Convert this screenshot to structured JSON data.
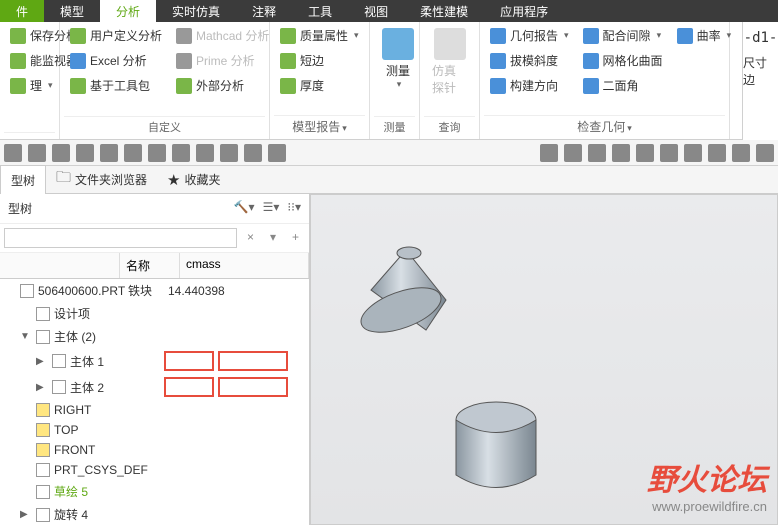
{
  "tabs": [
    "件",
    "模型",
    "分析",
    "实时仿真",
    "注释",
    "工具",
    "视图",
    "柔性建模",
    "应用程序"
  ],
  "activeTab": 2,
  "ribbon": {
    "g0": {
      "items": [
        "保存分析",
        "能监视器",
        "理"
      ],
      "label": ""
    },
    "g1": {
      "items": [
        "用户定义分析",
        "Excel 分析",
        "基于工具包",
        "Mathcad 分析",
        "Prime 分析",
        "外部分析"
      ],
      "label": "自定义"
    },
    "g2": {
      "items": [
        "质量属性",
        "短边",
        "厚度"
      ],
      "label": "模型报告"
    },
    "g3": {
      "big": "测量",
      "label": "测量"
    },
    "g4": {
      "big": "仿真探针",
      "label": "查询"
    },
    "g5": {
      "items": [
        "几何报告",
        "拔模斜度",
        "构建方向",
        "配合间隙",
        "网格化曲面",
        "二面角",
        "曲率"
      ],
      "label": "检查几何"
    }
  },
  "side": {
    "d1": "-d1-",
    "label": "尺寸边"
  },
  "panelTabs": [
    "型树",
    "文件夹浏览器",
    "收藏夹"
  ],
  "treeTitle": "型树",
  "searchPlaceholder": "",
  "columns": [
    "",
    "名称",
    "cmass"
  ],
  "rows": [
    {
      "i": 0,
      "label": "506400600.PRT",
      "name": "铁块",
      "cmass": "14.440398"
    },
    {
      "i": 1,
      "label": "设计项"
    },
    {
      "i": 1,
      "exp": "▼",
      "label": "主体 (2)"
    },
    {
      "i": 2,
      "exp": "▶",
      "label": "主体 1",
      "red": true
    },
    {
      "i": 2,
      "exp": "▶",
      "label": "主体 2",
      "red": true
    },
    {
      "i": 1,
      "label": "RIGHT",
      "ico": "y"
    },
    {
      "i": 1,
      "label": "TOP",
      "ico": "y"
    },
    {
      "i": 1,
      "label": "FRONT",
      "ico": "y"
    },
    {
      "i": 1,
      "label": "PRT_CSYS_DEF"
    },
    {
      "i": 1,
      "label": "草绘 5",
      "green": true
    },
    {
      "i": 1,
      "exp": "▶",
      "label": "旋转 4"
    }
  ],
  "watermark": {
    "main": "野火论坛",
    "sub": "www.proewildfire.cn"
  }
}
